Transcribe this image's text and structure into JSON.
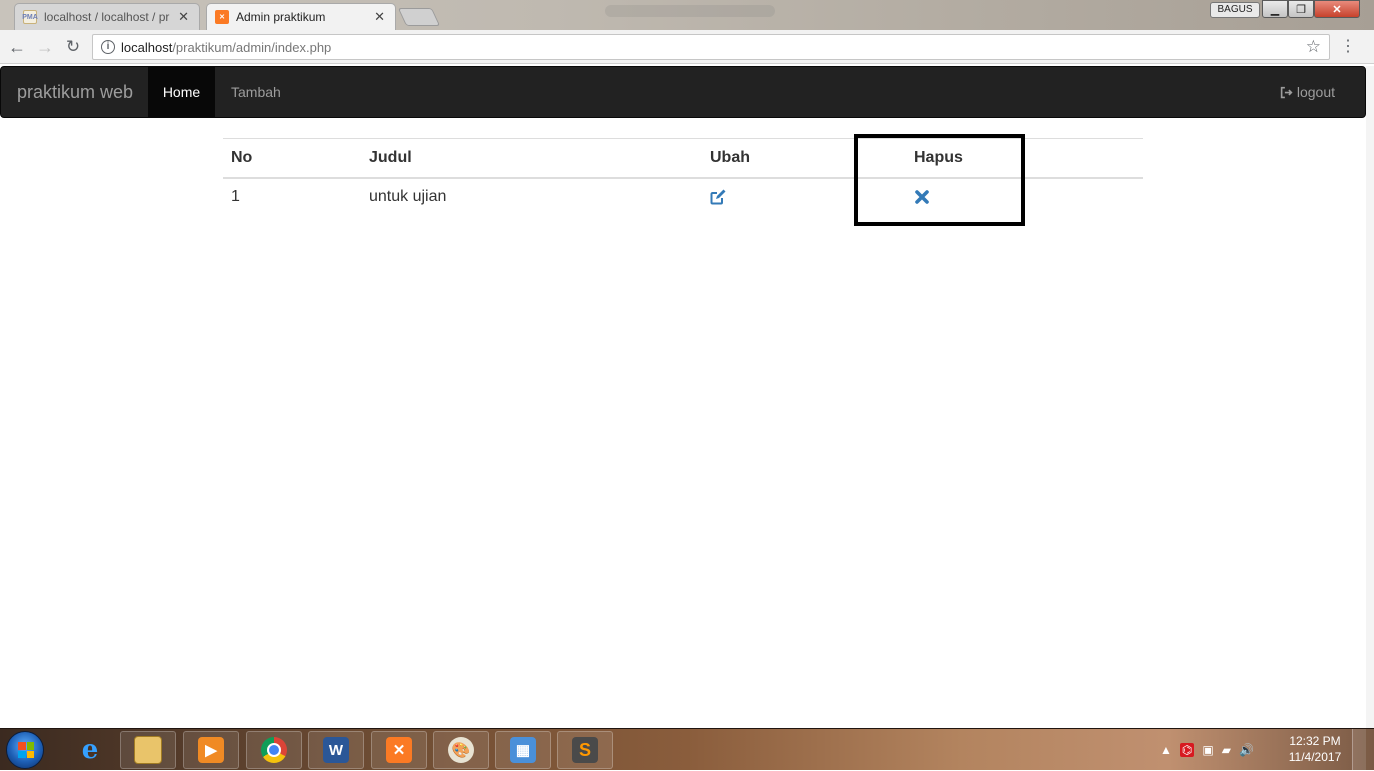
{
  "browser": {
    "tabs": [
      {
        "title": "localhost / localhost / pr",
        "favicon": "phpmyadmin-icon",
        "active": false
      },
      {
        "title": "Admin praktikum",
        "favicon": "xampp-icon",
        "active": true
      }
    ],
    "user_badge": "BAGUS",
    "address": {
      "host": "localhost",
      "path": "/praktikum/admin/index.php"
    }
  },
  "navbar": {
    "brand": "praktikum web",
    "items": [
      {
        "label": "Home",
        "active": true
      },
      {
        "label": "Tambah",
        "active": false
      }
    ],
    "logout_label": "logout"
  },
  "table": {
    "headers": [
      "No",
      "Judul",
      "Ubah",
      "Hapus"
    ],
    "rows": [
      {
        "no": "1",
        "judul": "untuk ujian",
        "ubah_icon": "edit-icon",
        "hapus_icon": "remove-icon"
      }
    ]
  },
  "colors": {
    "navbar_bg": "#222222",
    "navbar_active_bg": "#080808",
    "link_blue": "#337ab7",
    "highlight_border": "#000000"
  },
  "taskbar": {
    "apps": [
      "internet-explorer-icon",
      "file-explorer-icon",
      "media-player-icon",
      "chrome-icon",
      "word-icon",
      "xampp-icon",
      "paint-icon",
      "control-panel-icon",
      "sublime-text-icon"
    ],
    "clock_time": "12:32 PM",
    "clock_date": "11/4/2017"
  }
}
